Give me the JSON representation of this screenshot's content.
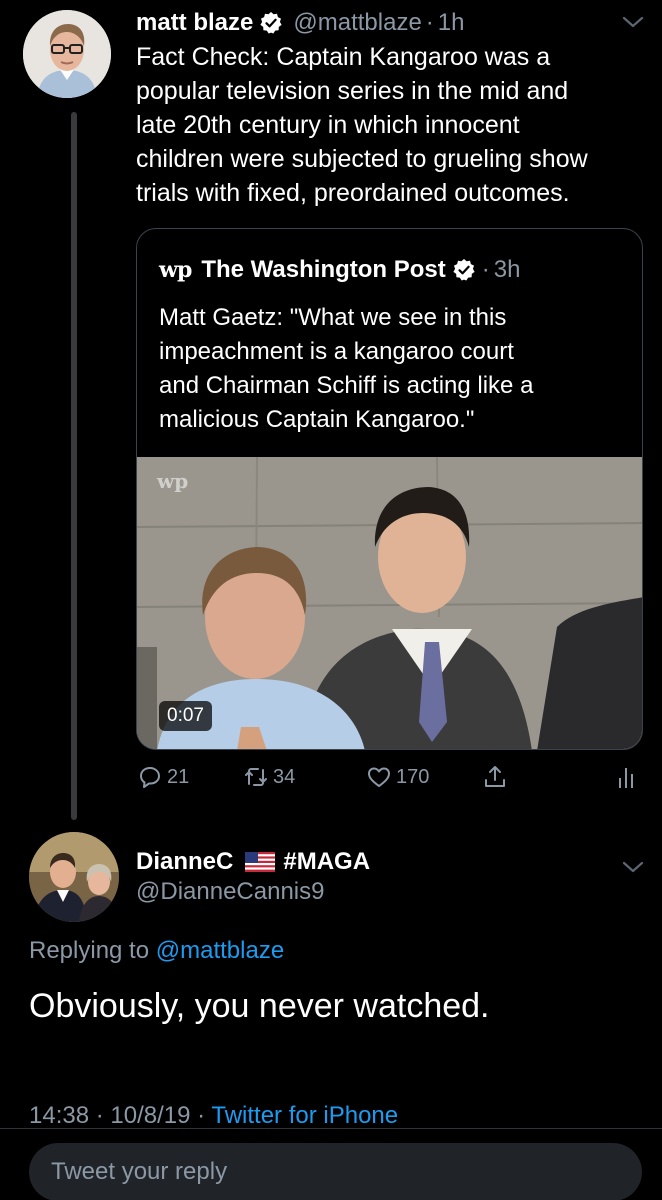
{
  "tweet": {
    "author_name": "matt blaze",
    "author_handle": "@mattblaze",
    "dot": "·",
    "time": "1h",
    "text": "Fact Check: Captain Kangaroo was a\npopular television series in the mid and\nlate 20th century in which innocent\nchildren were subjected to grueling show\ntrials with fixed, preordained outcomes.",
    "quote": {
      "logo": "wp",
      "author_name": "The Washington Post",
      "dot": "·",
      "time": "3h",
      "text": "Matt Gaetz: \"What we see in this\nimpeachment is a kangaroo court\nand Chairman Schiff is acting like a\nmalicious Captain Kangaroo.\"",
      "video": {
        "watermark": "wp",
        "duration": "0:07"
      }
    },
    "actions": {
      "replies": "21",
      "retweets": "34",
      "likes": "170"
    }
  },
  "reply": {
    "author_name": "DianneC",
    "author_suffix": "#MAGA",
    "author_handle": "@DianneCannis9",
    "replying_prefix": "Replying to",
    "replying_mention": "@mattblaze",
    "text": "Obviously, you never watched.",
    "timestamp": "14:38 · 10/8/19 ·",
    "source": "Twitter for iPhone"
  },
  "compose": {
    "placeholder": "Tweet your reply"
  },
  "colors": {
    "background": "#000000",
    "text_primary": "#ffffff",
    "text_secondary": "#8b98a5",
    "link": "#1d9bf0",
    "border": "#38444d"
  }
}
